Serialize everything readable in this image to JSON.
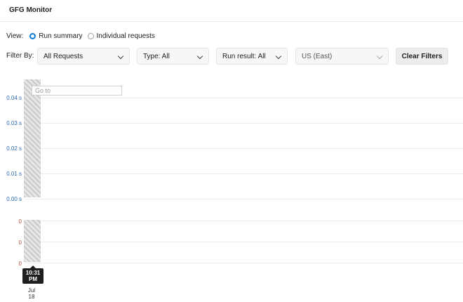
{
  "app": {
    "title": "GFG Monitor"
  },
  "view": {
    "label": "View:",
    "options": [
      {
        "label": "Run summary",
        "selected": true
      },
      {
        "label": "Individual requests",
        "selected": false
      }
    ]
  },
  "filters": {
    "label": "Filter By:",
    "requests": "All Requests",
    "type": "Type: All",
    "run_result": "Run result: All",
    "region": "US (East)",
    "clear_label": "Clear Filters"
  },
  "chart": {
    "goto_placeholder": "Go to",
    "response_ticks": [
      "0.04 s",
      "0.03 s",
      "0.02 s",
      "0.01 s",
      "0.00 s"
    ],
    "count_ticks": [
      "0",
      "0",
      "0"
    ],
    "time_label_line1": "10:31",
    "time_label_line2": "PM",
    "date_line1": "Jul",
    "date_line2": "18",
    "colors": {
      "response_axis": "#2b6cb0",
      "count_axis": "#b5523b",
      "accent": "#0a7ad8"
    }
  }
}
